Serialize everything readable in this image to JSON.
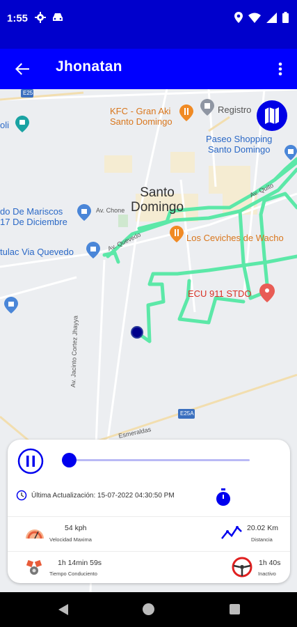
{
  "status_bar": {
    "time": "1:55",
    "icons_left": [
      "gear-icon",
      "car-icon"
    ],
    "icons_right": [
      "location-icon",
      "wifi-icon",
      "signal-icon",
      "battery-icon"
    ]
  },
  "app_bar": {
    "title": "Jhonatan",
    "back_icon": "arrow-back-icon",
    "menu_icon": "more-vert-icon"
  },
  "map": {
    "pois": {
      "kfc": "KFC - Gran Aki\nSanto Domingo",
      "registro": "Registro",
      "oli": "oli",
      "paseo": "Paseo Shopping\nSanto Domingo",
      "city": "Santo\nDomingo",
      "mariscos": "do De Mariscos\n17 De Diciembre",
      "ceviches": "Los Ceviches de Wacho",
      "agrocalidad": "tulac Via Quevedo",
      "ecu911": "ECU 911 STDO"
    },
    "roads": {
      "chone": "Av. Chone",
      "quevedo": "Av. Quevedo",
      "quito": "Av. Quito",
      "jacinto": "Av. Jacinto Cortez Jhayya",
      "esmeraldas": "Esmeraldas",
      "e25a_top": "E25",
      "e25a_bottom": "E25A"
    },
    "route_color": "#5ce8a8",
    "vehicle_color": "#00008b",
    "layers_icon": "map-layers-icon"
  },
  "panel": {
    "playback": {
      "state": "paused",
      "icon": "pause-icon",
      "progress": 0.0
    },
    "last_update_label": "Última Actualización: 15-07-2022 04:30:50 PM",
    "stats": {
      "max_speed": {
        "value": "54 kph",
        "label": "Velocidad Maxima",
        "icon": "speedometer-icon"
      },
      "distance": {
        "value": "20.02 Km",
        "label": "Distancia",
        "icon": "route-chart-icon"
      },
      "driving_time": {
        "value": "1h 14min 59s",
        "label": "Tiempo Conduciento",
        "icon": "pistons-icon"
      },
      "idle": {
        "value": "1h 40s",
        "label": "Inactivo",
        "icon": "steering-wheel-icon"
      }
    }
  },
  "nav": {
    "back_icon": "nav-back-icon",
    "home_icon": "nav-home-icon",
    "recent_icon": "nav-recent-icon"
  }
}
